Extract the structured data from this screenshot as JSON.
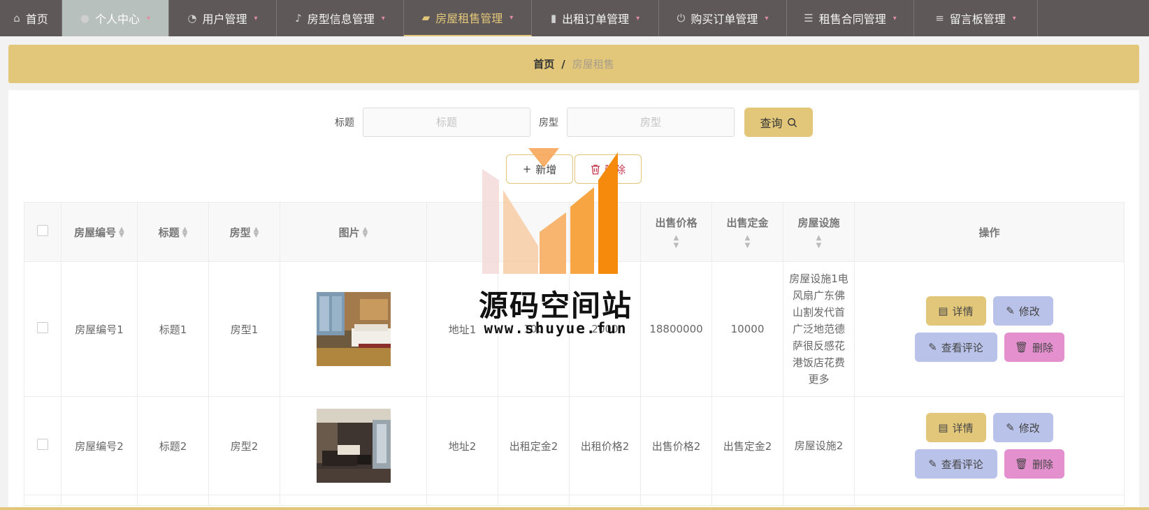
{
  "nav": {
    "items": [
      {
        "label": "首页",
        "icon": "home-icon"
      },
      {
        "label": "个人中心",
        "icon": "user-icon"
      },
      {
        "label": "用户管理",
        "icon": "dashboard-icon"
      },
      {
        "label": "房型信息管理",
        "icon": "microphone-icon"
      },
      {
        "label": "房屋租售管理",
        "icon": "wallet-icon"
      },
      {
        "label": "出租订单管理",
        "icon": "printer-icon"
      },
      {
        "label": "购买订单管理",
        "icon": "power-icon"
      },
      {
        "label": "租售合同管理",
        "icon": "sliders-icon"
      },
      {
        "label": "留言板管理",
        "icon": "list-icon"
      }
    ]
  },
  "breadcrumb": {
    "home": "首页",
    "sep": "/",
    "current": "房屋租售"
  },
  "search": {
    "title_label": "标题",
    "title_placeholder": "标题",
    "type_label": "房型",
    "type_placeholder": "房型",
    "query_label": "查询"
  },
  "actions": {
    "add_label": "新增",
    "delete_label": "删除"
  },
  "table": {
    "headers": [
      "房屋编号",
      "标题",
      "房型",
      "图片",
      "",
      "",
      "",
      "出售价格",
      "出售定金",
      "房屋设施",
      "操作"
    ],
    "rows": [
      {
        "id": "房屋编号1",
        "title": "标题1",
        "type": "房型1",
        "address": "地址1",
        "rent_deposit": "100",
        "rent_price": "2000",
        "sale_price": "18800000",
        "sale_deposit": "10000",
        "facility": "房屋设施1电风扇广东佛山割发代首广泛地范德萨很反感花港饭店花费更多"
      },
      {
        "id": "房屋编号2",
        "title": "标题2",
        "type": "房型2",
        "address": "地址2",
        "rent_deposit": "出租定金2",
        "rent_price": "出租价格2",
        "sale_price": "出售价格2",
        "sale_deposit": "出售定金2",
        "facility": "房屋设施2"
      }
    ],
    "row_ops": {
      "detail": "详情",
      "edit": "修改",
      "review": "查看评论",
      "delete": "删除"
    }
  },
  "watermark": {
    "title": "源码空间站",
    "url": "www.shuyue.fun"
  },
  "colors": {
    "nav_bg": "#5e5859",
    "accent": "#e2c77a",
    "edit_btn": "#b9c2e8",
    "delete_btn": "#e48fce",
    "danger_text": "#c4384c"
  }
}
